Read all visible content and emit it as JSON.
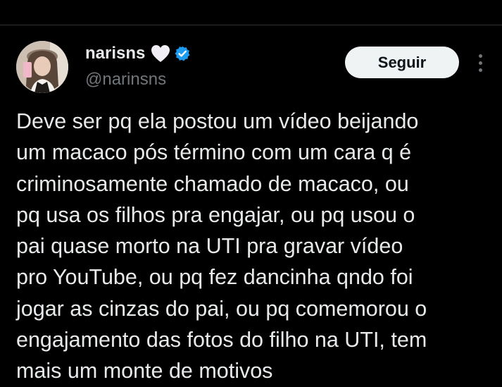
{
  "author": {
    "display_name": "narisns",
    "handle": "@narinsns",
    "name_emoji": "white-heart-icon",
    "verified_icon": "verified-badge-icon",
    "verified_color": "#1d9bf0"
  },
  "actions": {
    "follow_label": "Seguir",
    "more_icon": "more-options-icon"
  },
  "tweet": {
    "text": "Deve ser pq ela postou um vídeo beijando\num macaco pós término com um cara q é\ncriminosamente chamado de macaco, ou\npq usa os filhos pra engajar, ou pq usou o\npai quase morto na UTI pra gravar vídeo\npro YouTube, ou pq fez dancinha qndo foi\njogar as cinzas do pai, ou pq comemorou o\nengajamento das fotos do filho na UTI, tem\nmais um monte de motivos"
  },
  "colors": {
    "background": "#000000",
    "text_primary": "#e7e9ea",
    "text_secondary": "#71767b",
    "button_bg": "#eff3f4",
    "button_text": "#0f1419",
    "divider": "#2f3336"
  }
}
